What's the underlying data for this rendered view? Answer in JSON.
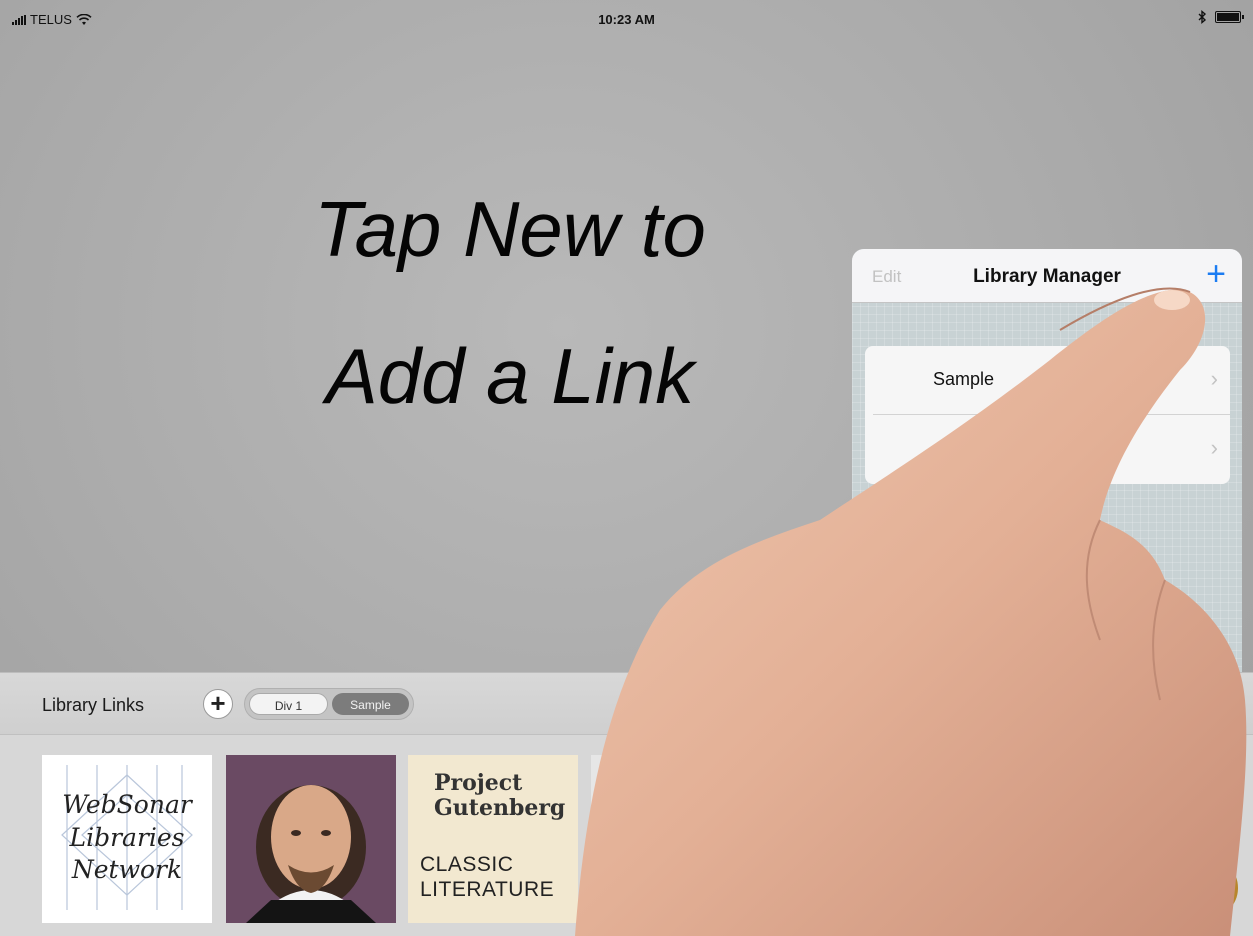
{
  "status_bar": {
    "carrier": "TELUS",
    "time": "10:23 AM"
  },
  "headline": {
    "line1": "Tap New to",
    "line2": "Add a Link"
  },
  "library_manager": {
    "edit_label": "Edit",
    "title": "Library Manager",
    "add_label": "+",
    "rows": [
      {
        "label": "Sample"
      },
      {
        "label": ""
      }
    ]
  },
  "toolbar": {
    "title": "Library Links",
    "add_label": "+",
    "segments": [
      "Div 1",
      "Sample"
    ],
    "selected_segment": "Sample"
  },
  "thumbnails": {
    "websonar": "WebSonar Libraries Network",
    "websonar_lines": [
      "WebSonar",
      "Libraries",
      "Network"
    ],
    "gutenberg_title": [
      "Project",
      "Gutenberg"
    ],
    "gutenberg_subtitle": [
      "CLASSIC",
      "LITERATURE"
    ]
  },
  "colors": {
    "accent": "#1b7cf2",
    "gutenberg_red": "#8e1a16"
  },
  "icons": [
    "signal-icon",
    "wifi-icon",
    "bluetooth-icon",
    "battery-icon",
    "plus-icon",
    "chevron-right-icon",
    "ship-wheel-icon"
  ]
}
